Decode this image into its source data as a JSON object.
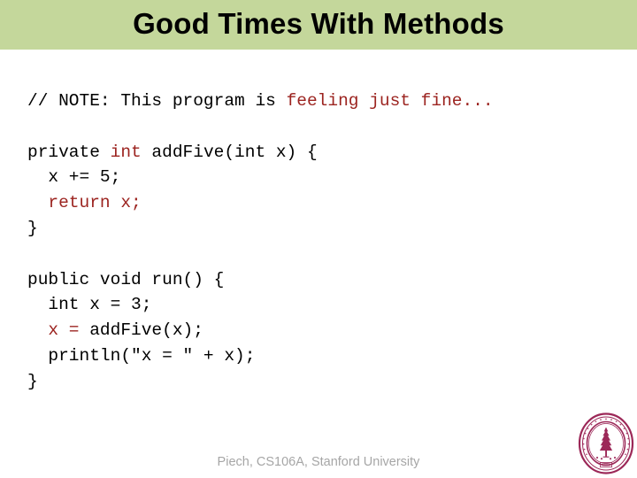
{
  "slide": {
    "title": "Good Times With Methods",
    "banner_color": "#c4d79b",
    "background_color": "#ffffff"
  },
  "code": {
    "font": "monospace",
    "plain_color": "#000000",
    "keyword_color": "#9c2420",
    "lines": [
      {
        "id": "line-comment",
        "segments": [
          {
            "text": "// NOTE: This program is ",
            "style": "plain"
          },
          {
            "text": "feeling just fine...",
            "style": "keyword"
          }
        ]
      },
      {
        "id": "line-blank-1",
        "segments": [
          {
            "text": "",
            "style": "plain"
          }
        ]
      },
      {
        "id": "line-addfive-signature",
        "segments": [
          {
            "text": "private ",
            "style": "plain"
          },
          {
            "text": "int",
            "style": "keyword"
          },
          {
            "text": " addFive(int x) {",
            "style": "plain"
          }
        ]
      },
      {
        "id": "line-x-plus-equals",
        "segments": [
          {
            "text": "  x += 5;",
            "style": "plain"
          }
        ]
      },
      {
        "id": "line-return-x",
        "segments": [
          {
            "text": "  ",
            "style": "plain"
          },
          {
            "text": "return x;",
            "style": "keyword"
          }
        ]
      },
      {
        "id": "line-close-addfive",
        "segments": [
          {
            "text": "}",
            "style": "plain"
          }
        ]
      },
      {
        "id": "line-blank-2",
        "segments": [
          {
            "text": "",
            "style": "plain"
          }
        ]
      },
      {
        "id": "line-run-signature",
        "segments": [
          {
            "text": "public void run() {",
            "style": "plain"
          }
        ]
      },
      {
        "id": "line-int-x-3",
        "segments": [
          {
            "text": "  int x = 3;",
            "style": "plain"
          }
        ]
      },
      {
        "id": "line-call-addfive",
        "segments": [
          {
            "text": "  ",
            "style": "plain"
          },
          {
            "text": "x = ",
            "style": "keyword"
          },
          {
            "text": "addFive(x);",
            "style": "plain"
          }
        ]
      },
      {
        "id": "line-println",
        "segments": [
          {
            "text": "  println(\"x = \" + x);",
            "style": "plain"
          }
        ]
      },
      {
        "id": "line-close-run",
        "segments": [
          {
            "text": "}",
            "style": "plain"
          }
        ]
      }
    ]
  },
  "footer": {
    "credit": "Piech, CS106A, Stanford University",
    "credit_color": "#a6a6a6"
  },
  "seal": {
    "name": "stanford-university-seal",
    "ring_text": "THE LELAND STANFORD JUNIOR UNIVERSITY",
    "year": "1891",
    "color": "#9c2858"
  }
}
